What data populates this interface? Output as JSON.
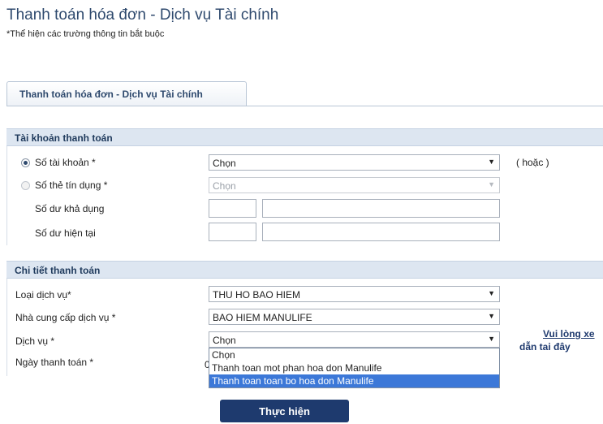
{
  "page": {
    "title": "Thanh toán hóa đơn - Dịch vụ Tài chính",
    "note": "*Thể hiện các trường thông tin bắt buộc"
  },
  "tab": {
    "label": "Thanh toán hóa đơn - Dịch vụ Tài chính"
  },
  "account_section": {
    "heading": "Tài khoản thanh toán",
    "account_label": "Số tài khoản *",
    "account_value": "Chọn",
    "or_text": "( hoặc )",
    "card_label": "Số thẻ tín dụng *",
    "card_value": "Chọn",
    "available_label": "Số dư khả dụng",
    "current_label": "Số dư hiện tại"
  },
  "payment_section": {
    "heading": "Chi tiết thanh toán",
    "service_type_label": "Loại dịch vụ*",
    "service_type_value": "THU HO BAO HIEM",
    "provider_label": "Nhà cung cấp dịch vụ *",
    "provider_value": "BAO HIEM MANULIFE",
    "service_label": "Dịch vụ *",
    "service_value": "Chọn",
    "date_label": "Ngày thanh toán *",
    "date_value_partial": "0",
    "help_link_line1": "Vui lòng xe",
    "help_link_line2": "dẫn tai đây",
    "service_options": [
      "Chọn",
      "Thanh toan mot phan hoa don Manulife",
      "Thanh toan toan bo hoa don Manulife"
    ],
    "selected_option_index": 2
  },
  "submit_label": "Thực hiện"
}
